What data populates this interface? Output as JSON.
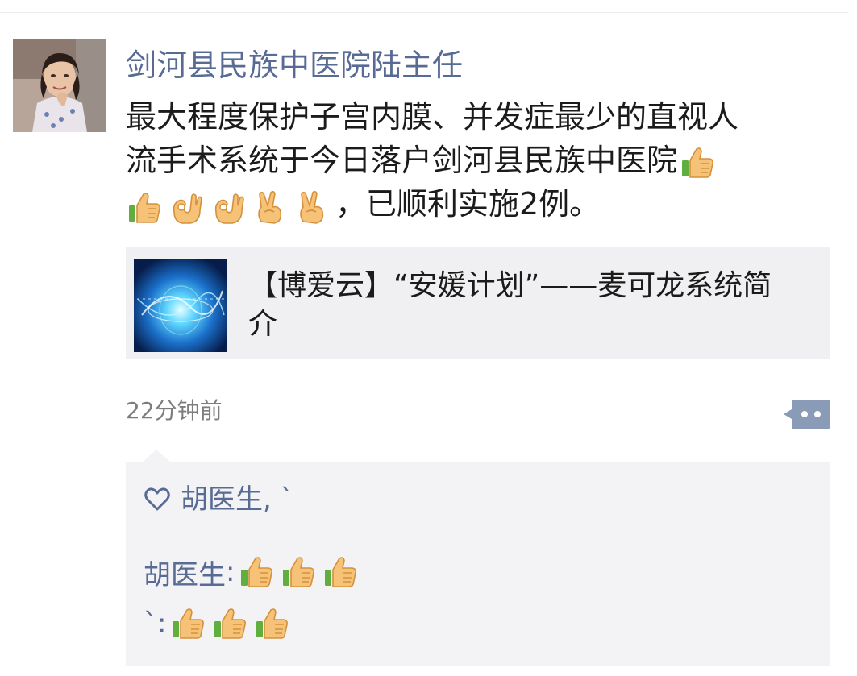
{
  "post": {
    "author": "剑河县民族中医院陆主任",
    "text_line1": "最大程度保护子宫内膜、并发症最少的直视人",
    "text_line2": "流手术系统于今日落户剑河县民族中医院",
    "text_line3_suffix": "，已顺利实施2例。",
    "emojis_line2": [
      "thumbs-up"
    ],
    "emojis_line3": [
      "thumbs-up",
      "ok-hand",
      "ok-hand",
      "victory-hand",
      "victory-hand"
    ]
  },
  "link_card": {
    "title_line1": "【博爱云】“安媛计划”——麦可龙系统简",
    "title_line2": "介"
  },
  "meta": {
    "timestamp": "22分钟前"
  },
  "likes": {
    "names": "胡医生,  `"
  },
  "comments": [
    {
      "author": "胡医生",
      "separator": ":",
      "emojis": [
        "thumbs-up",
        "thumbs-up",
        "thumbs-up"
      ]
    },
    {
      "author": "`",
      "separator": ":",
      "emojis": [
        "thumbs-up",
        "thumbs-up",
        "thumbs-up"
      ]
    }
  ],
  "colors": {
    "link_blue": "#576b95",
    "text": "#1b1b1b",
    "muted": "#7d7d7d",
    "card_bg": "#f0f0f2",
    "comment_bg": "#f3f3f5"
  }
}
